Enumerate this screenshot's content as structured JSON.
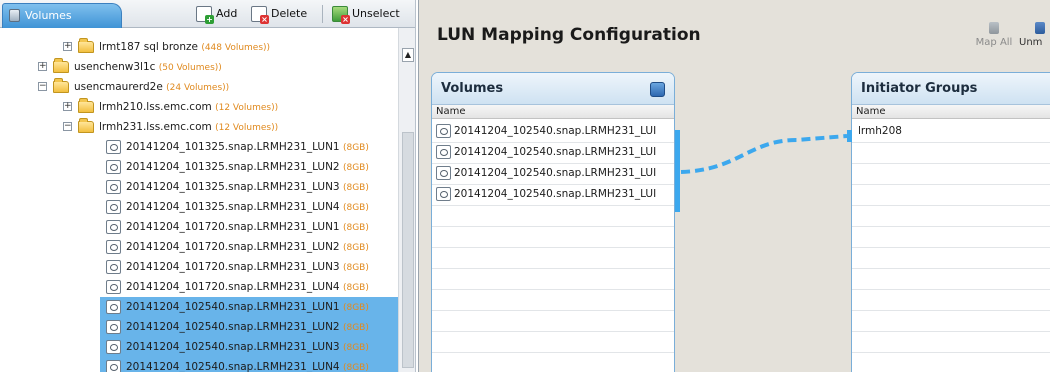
{
  "left_toolbar": {
    "tab_label": "Volumes",
    "add_label": "Add",
    "delete_label": "Delete",
    "unselect_label": "Unselect"
  },
  "tree": [
    {
      "label": "lrmt187 sql bronze",
      "meta": "(448 Volumes))",
      "type": "folder",
      "expander": "+",
      "indent": 1,
      "selected": false
    },
    {
      "label": "usenchenw3l1c",
      "meta": "(50 Volumes))",
      "type": "folder",
      "expander": "+",
      "indent": 0,
      "selected": false
    },
    {
      "label": "usencmaurerd2e",
      "meta": "(24 Volumes))",
      "type": "folder",
      "expander": "−",
      "indent": 0,
      "selected": false
    },
    {
      "label": "lrmh210.lss.emc.com",
      "meta": "(12 Volumes))",
      "type": "folder",
      "expander": "+",
      "indent": 1,
      "selected": false
    },
    {
      "label": "lrmh231.lss.emc.com",
      "meta": "(12 Volumes))",
      "type": "folder",
      "expander": "−",
      "indent": 1,
      "selected": false
    },
    {
      "label": "20141204_101325.snap.LRMH231_LUN1",
      "meta": "(8GB)",
      "type": "volume",
      "indent": 2,
      "selected": false
    },
    {
      "label": "20141204_101325.snap.LRMH231_LUN2",
      "meta": "(8GB)",
      "type": "volume",
      "indent": 2,
      "selected": false
    },
    {
      "label": "20141204_101325.snap.LRMH231_LUN3",
      "meta": "(8GB)",
      "type": "volume",
      "indent": 2,
      "selected": false
    },
    {
      "label": "20141204_101325.snap.LRMH231_LUN4",
      "meta": "(8GB)",
      "type": "volume",
      "indent": 2,
      "selected": false
    },
    {
      "label": "20141204_101720.snap.LRMH231_LUN1",
      "meta": "(8GB)",
      "type": "volume",
      "indent": 2,
      "selected": false
    },
    {
      "label": "20141204_101720.snap.LRMH231_LUN2",
      "meta": "(8GB)",
      "type": "volume",
      "indent": 2,
      "selected": false
    },
    {
      "label": "20141204_101720.snap.LRMH231_LUN3",
      "meta": "(8GB)",
      "type": "volume",
      "indent": 2,
      "selected": false
    },
    {
      "label": "20141204_101720.snap.LRMH231_LUN4",
      "meta": "(8GB)",
      "type": "volume",
      "indent": 2,
      "selected": false
    },
    {
      "label": "20141204_102540.snap.LRMH231_LUN1",
      "meta": "(8GB)",
      "type": "volume",
      "indent": 2,
      "selected": true
    },
    {
      "label": "20141204_102540.snap.LRMH231_LUN2",
      "meta": "(8GB)",
      "type": "volume",
      "indent": 2,
      "selected": true
    },
    {
      "label": "20141204_102540.snap.LRMH231_LUN3",
      "meta": "(8GB)",
      "type": "volume",
      "indent": 2,
      "selected": true
    },
    {
      "label": "20141204_102540.snap.LRMH231_LUN4",
      "meta": "(8GB)",
      "type": "volume",
      "indent": 2,
      "selected": true
    }
  ],
  "config": {
    "title": "LUN Mapping Configuration",
    "map_all_label": "Map All",
    "unmap_label": "Unm"
  },
  "volumes_panel": {
    "title": "Volumes",
    "column": "Name",
    "rows": [
      "20141204_102540.snap.LRMH231_LUI",
      "20141204_102540.snap.LRMH231_LUI",
      "20141204_102540.snap.LRMH231_LUI",
      "20141204_102540.snap.LRMH231_LUI"
    ]
  },
  "initiator_groups_panel": {
    "title": "Initiator Groups",
    "column": "Name",
    "rows": [
      "lrmh208"
    ]
  },
  "colors": {
    "selection": "#68b4ea",
    "connector": "#3ca8ee",
    "pane_background": "#e4e1da"
  }
}
